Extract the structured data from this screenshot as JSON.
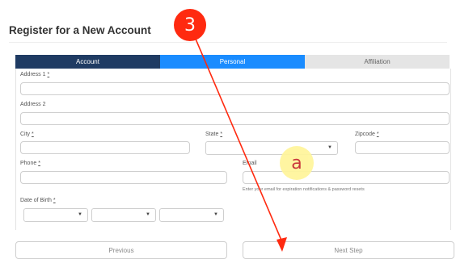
{
  "page": {
    "title": "Register for a New Account"
  },
  "tabs": [
    {
      "label": "Account"
    },
    {
      "label": "Personal"
    },
    {
      "label": "Affiliation"
    }
  ],
  "form": {
    "address1": {
      "label": "Address 1",
      "required_mark": "*",
      "value": ""
    },
    "address2": {
      "label": "Address 2",
      "value": ""
    },
    "city": {
      "label": "City",
      "required_mark": "*",
      "value": ""
    },
    "state": {
      "label": "State",
      "required_mark": "*",
      "value": ""
    },
    "zipcode": {
      "label": "Zipcode",
      "required_mark": "*",
      "value": ""
    },
    "phone": {
      "label": "Phone",
      "required_mark": "*",
      "value": ""
    },
    "email": {
      "label": "Email",
      "value": "",
      "help": "Enter your email for expiration notifications & password resets"
    },
    "dob": {
      "label": "Date of Birth",
      "required_mark": "*"
    }
  },
  "buttons": {
    "previous": "Previous",
    "next": "Next Step"
  },
  "annotations": {
    "step_badge": "3",
    "marker_badge": "a",
    "colors": {
      "step": "#ff2a10",
      "marker": "#fff59a",
      "arrow": "#ff2a10"
    }
  }
}
